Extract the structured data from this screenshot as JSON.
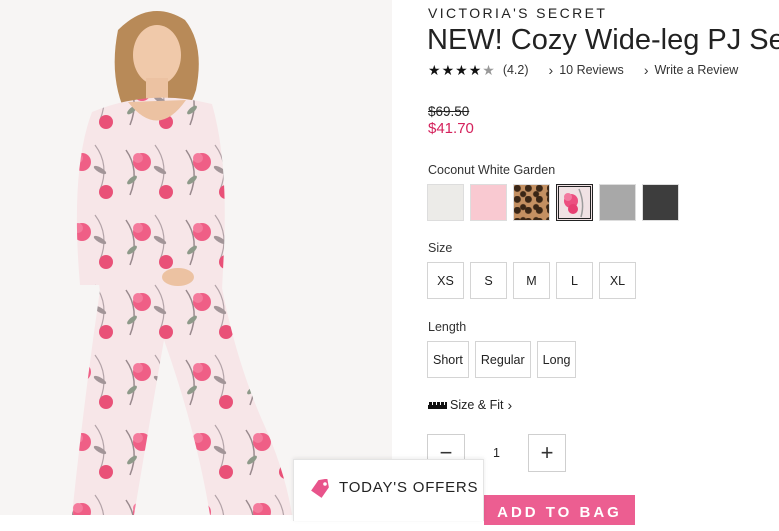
{
  "product": {
    "brand": "VICTORIA'S SECRET",
    "title": "NEW! Cozy Wide-leg PJ Set",
    "rating_value": 4.2,
    "rating_text": "(4.2)",
    "reviews_link": "10 Reviews",
    "write_review_link": "Write a Review",
    "original_price": "$69.50",
    "sale_price": "$41.70"
  },
  "color": {
    "selected_name": "Coconut White Garden",
    "swatches": [
      {
        "name": "off-white",
        "color": "#ecebe8"
      },
      {
        "name": "pink",
        "color": "#f9c9d1"
      },
      {
        "name": "leopard",
        "color": "#b98a5c"
      },
      {
        "name": "coconut-white-garden",
        "color": "#e9c6cf",
        "selected": true
      },
      {
        "name": "heather-gray",
        "color": "#a9a9a9"
      },
      {
        "name": "charcoal",
        "color": "#3b3b3b"
      }
    ]
  },
  "size": {
    "label": "Size",
    "options": [
      "XS",
      "S",
      "M",
      "L",
      "XL"
    ]
  },
  "length": {
    "label": "Length",
    "options": [
      "Short",
      "Regular",
      "Long"
    ]
  },
  "size_fit_link": "Size & Fit",
  "quantity": {
    "minus": "−",
    "value": "1",
    "plus": "+"
  },
  "add_to_bag": "ADD TO BAG",
  "offers_tab": "TODAY'S OFFERS",
  "colors": {
    "accent_pink": "#ec5e91",
    "sale_price": "#d4225c"
  }
}
